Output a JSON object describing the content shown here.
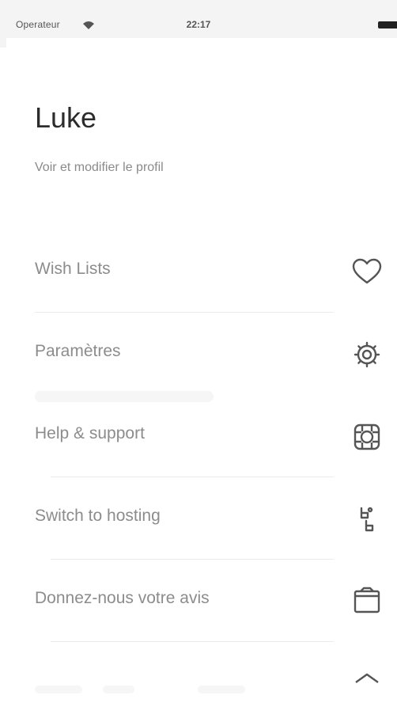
{
  "status_bar": {
    "carrier": "Operateur",
    "time": "22:17"
  },
  "profile": {
    "name": "Luke",
    "link": "Voir et modifier le profil"
  },
  "menu": {
    "items": [
      {
        "label": "Wish Lists",
        "icon": "heart-icon"
      },
      {
        "label": "Paramètres",
        "icon": "gear-icon"
      },
      {
        "label": "Help & support",
        "icon": "support-lifebuoy-icon"
      },
      {
        "label": "Switch to hosting",
        "icon": "switch-hosting-icon"
      },
      {
        "label": "Donnez-nous votre avis",
        "icon": "feedback-icon"
      }
    ]
  }
}
